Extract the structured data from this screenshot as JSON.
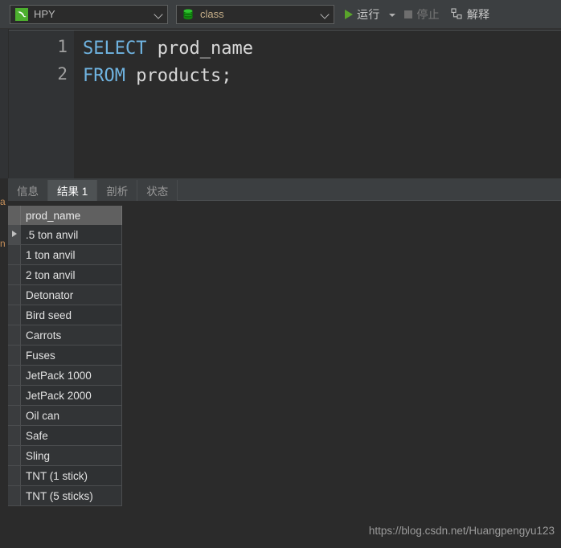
{
  "toolbar": {
    "connection": {
      "icon": "dolphin-icon",
      "value": "HPY",
      "chevron": "chevron-down-icon"
    },
    "database": {
      "icon": "database-icon",
      "value": "class",
      "chevron": "chevron-down-icon"
    },
    "run_button": {
      "label": "运行",
      "icon": "play-icon",
      "dropdown_icon": "caret-down-icon",
      "enabled": true
    },
    "stop_button": {
      "label": "停止",
      "icon": "stop-square-icon",
      "enabled": false
    },
    "explain_button": {
      "label": "解释",
      "icon": "explain-icon",
      "enabled": true
    }
  },
  "editor": {
    "line_numbers": [
      "1",
      "2"
    ],
    "lines": [
      {
        "keyword": "SELECT",
        "rest": " prod_name"
      },
      {
        "keyword": "FROM",
        "rest": " products;"
      }
    ]
  },
  "tabs": [
    {
      "label": "信息",
      "active": false
    },
    {
      "label": "结果 1",
      "active": true
    },
    {
      "label": "剖析",
      "active": false
    },
    {
      "label": "状态",
      "active": false
    }
  ],
  "results": {
    "columns": [
      "prod_name"
    ],
    "current_row_index": 0,
    "row_indicator_icon": "row-caret-icon",
    "rows": [
      [
        ".5 ton anvil"
      ],
      [
        "1 ton anvil"
      ],
      [
        "2 ton anvil"
      ],
      [
        "Detonator"
      ],
      [
        "Bird seed"
      ],
      [
        "Carrots"
      ],
      [
        "Fuses"
      ],
      [
        "JetPack 1000"
      ],
      [
        "JetPack 2000"
      ],
      [
        "Oil can"
      ],
      [
        "Safe"
      ],
      [
        "Sling"
      ],
      [
        "TNT (1 stick)"
      ],
      [
        "TNT (5 sticks)"
      ]
    ]
  },
  "left_rail": {
    "glyph_top": "a",
    "glyph_bottom": "n"
  },
  "watermark": "https://blog.csdn.net/Huangpengyu123",
  "colors": {
    "toolbar_bg": "#3c3f41",
    "editor_bg": "#2b2b2b",
    "gutter_bg": "#313335",
    "keyword": "#6fb3e0",
    "identifier": "#d8d8d8",
    "accent_green": "#5aa52b",
    "db_label": "#c8b08a",
    "grid_header_bg": "#606060",
    "active_tab_bg": "#4e5254"
  }
}
